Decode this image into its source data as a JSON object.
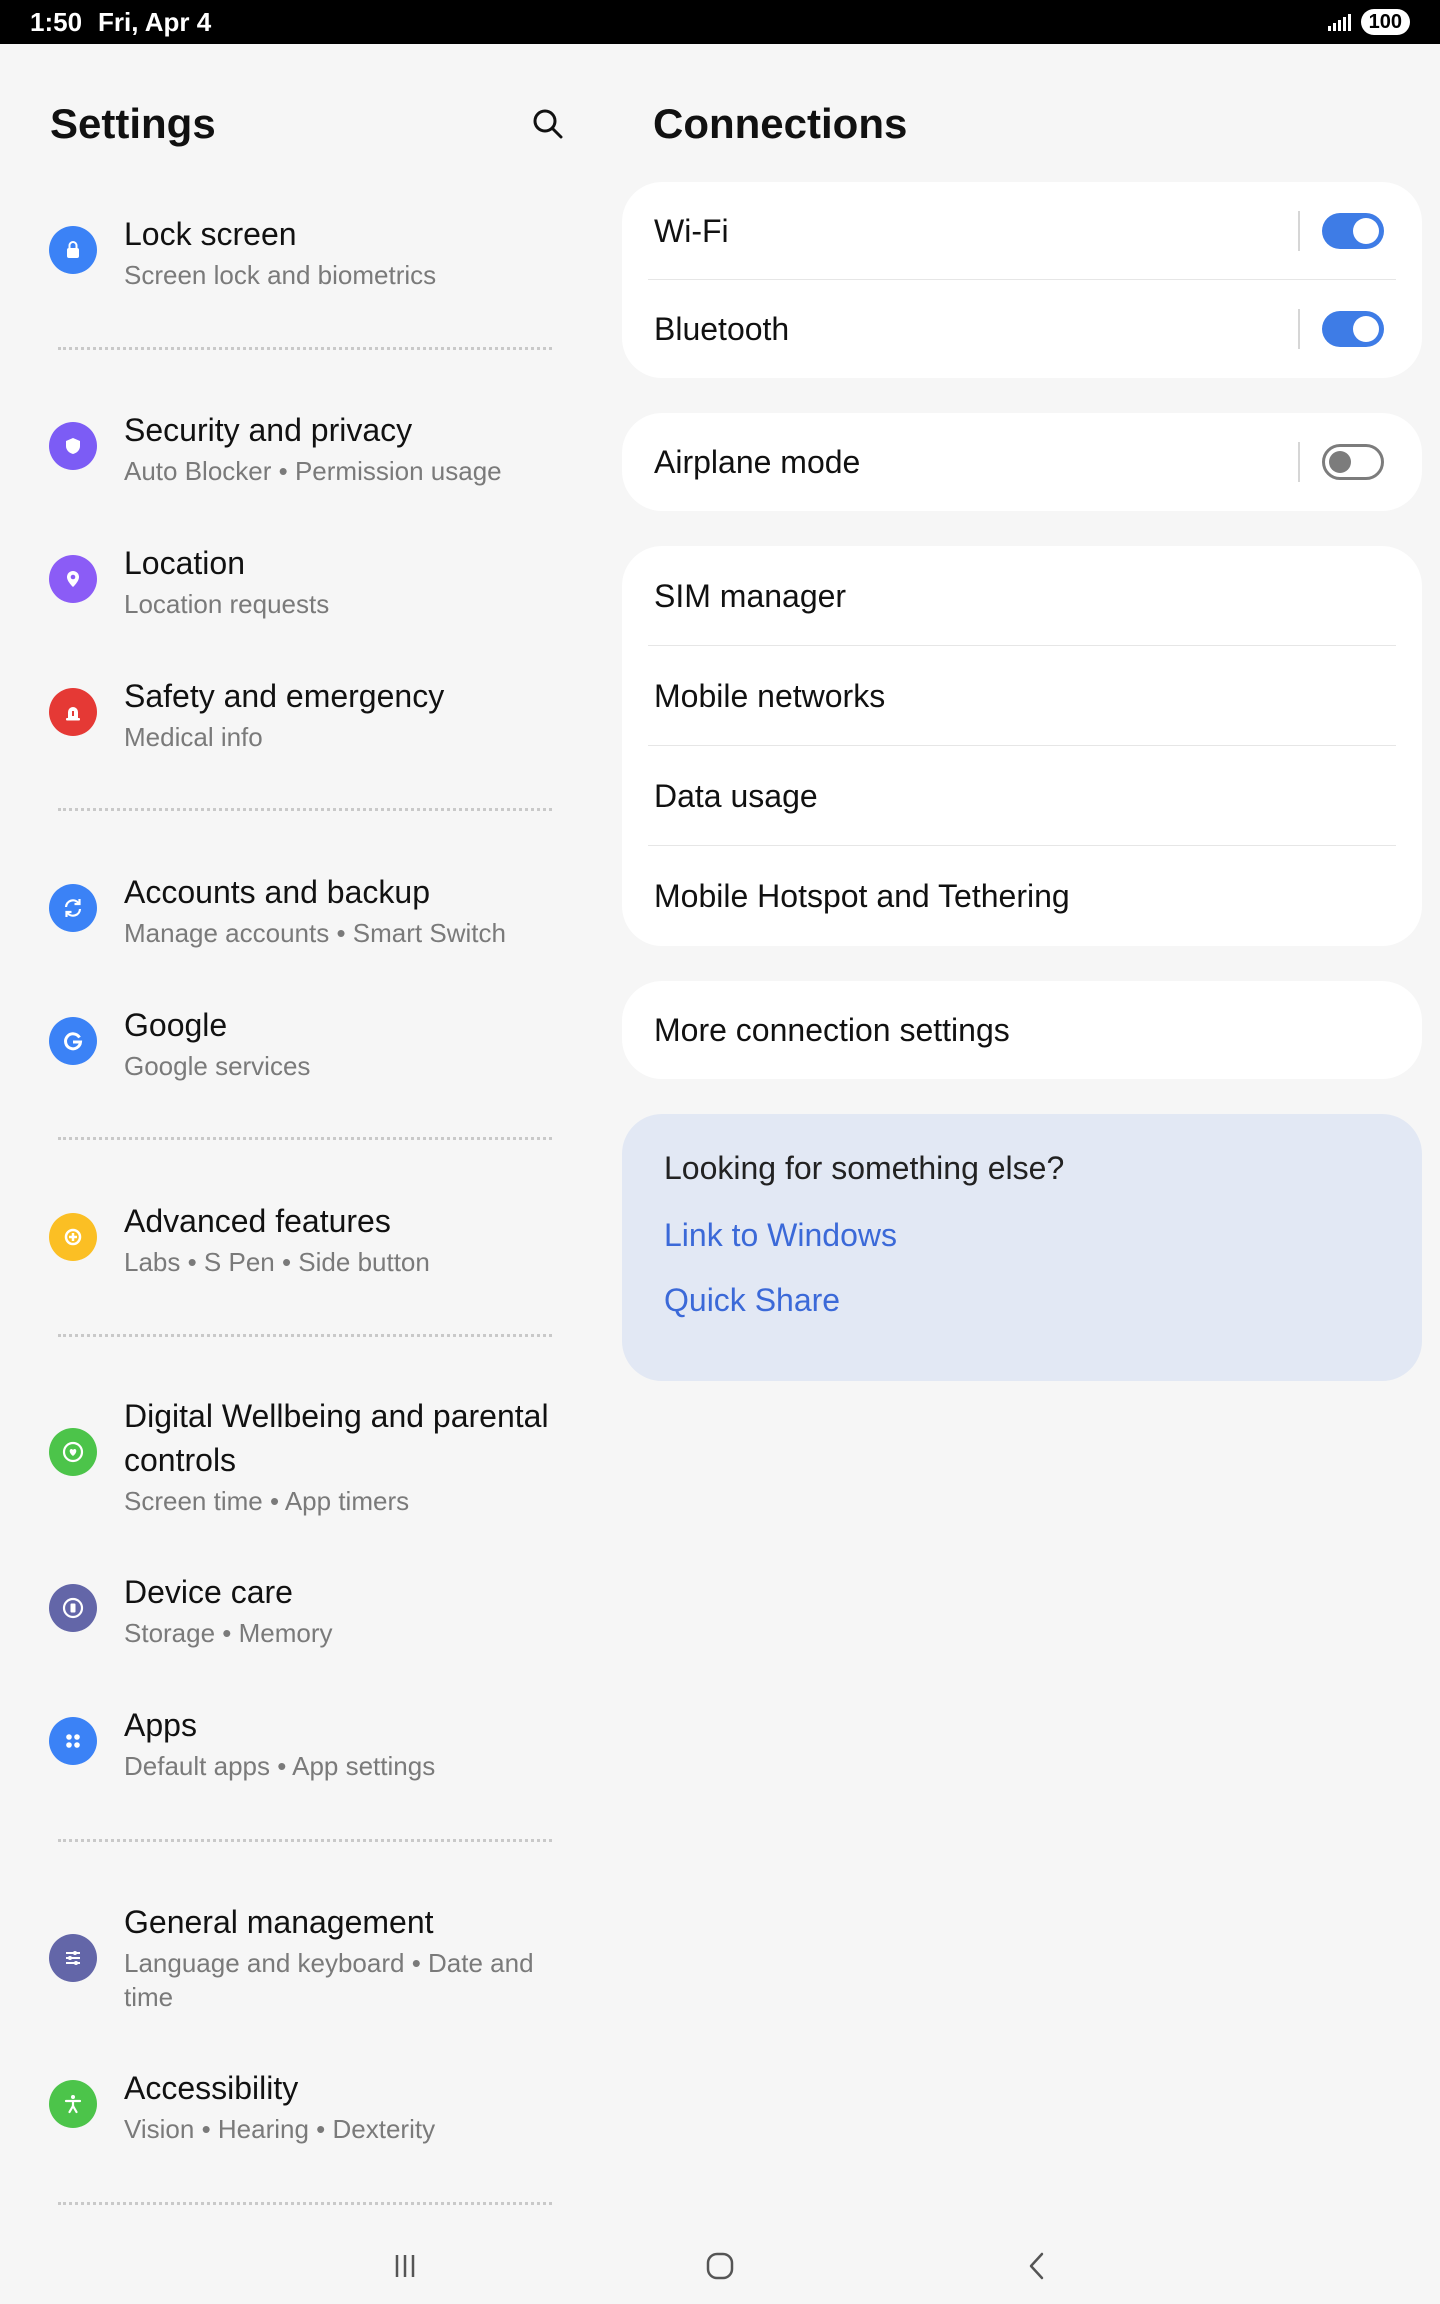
{
  "status_bar": {
    "time": "1:50",
    "date": "Fri, Apr 4",
    "battery": "100"
  },
  "settings": {
    "title": "Settings",
    "items": [
      {
        "title": "Lock screen",
        "subtitle": "Screen lock and biometrics",
        "icon": "lock-icon",
        "color": "#3b82f6"
      },
      {
        "title": "Security and privacy",
        "subtitle": "Auto Blocker  •  Permission usage",
        "icon": "shield-icon",
        "color": "#7c5cf5"
      },
      {
        "title": "Location",
        "subtitle": "Location requests",
        "icon": "location-pin-icon",
        "color": "#8b5cf6"
      },
      {
        "title": "Safety and emergency",
        "subtitle": "Medical info",
        "icon": "alert-icon",
        "color": "#e53935"
      },
      {
        "title": "Accounts and backup",
        "subtitle": "Manage accounts  •  Smart Switch",
        "icon": "sync-icon",
        "color": "#3b82f6"
      },
      {
        "title": "Google",
        "subtitle": "Google services",
        "icon": "google-icon",
        "color": "#3b82f6"
      },
      {
        "title": "Advanced features",
        "subtitle": "Labs  •  S Pen  •  Side button",
        "icon": "plus-gear-icon",
        "color": "#fbbf24"
      },
      {
        "title": "Digital Wellbeing and parental controls",
        "subtitle": "Screen time  •  App timers",
        "icon": "wellbeing-icon",
        "color": "#4cc44a"
      },
      {
        "title": "Device care",
        "subtitle": "Storage  •  Memory",
        "icon": "device-care-icon",
        "color": "#6366a8"
      },
      {
        "title": "Apps",
        "subtitle": "Default apps  •  App settings",
        "icon": "apps-grid-icon",
        "color": "#3b82f6"
      },
      {
        "title": "General management",
        "subtitle": "Language and keyboard  •  Date and time",
        "icon": "sliders-icon",
        "color": "#6366a8"
      },
      {
        "title": "Accessibility",
        "subtitle": "Vision  •  Hearing  •  Dexterity",
        "icon": "accessibility-icon",
        "color": "#4cc44a"
      }
    ]
  },
  "connections": {
    "title": "Connections",
    "wifi": {
      "label": "Wi-Fi",
      "on": true
    },
    "bluetooth": {
      "label": "Bluetooth",
      "on": true
    },
    "airplane": {
      "label": "Airplane mode",
      "on": false
    },
    "sim": "SIM manager",
    "mobile_networks": "Mobile networks",
    "data_usage": "Data usage",
    "hotspot": "Mobile Hotspot and Tethering",
    "more": "More connection settings"
  },
  "looking_for": {
    "title": "Looking for something else?",
    "links": [
      "Link to Windows",
      "Quick Share"
    ]
  },
  "colors": {
    "accent": "#3e7ce6",
    "link": "#3b69d8"
  }
}
